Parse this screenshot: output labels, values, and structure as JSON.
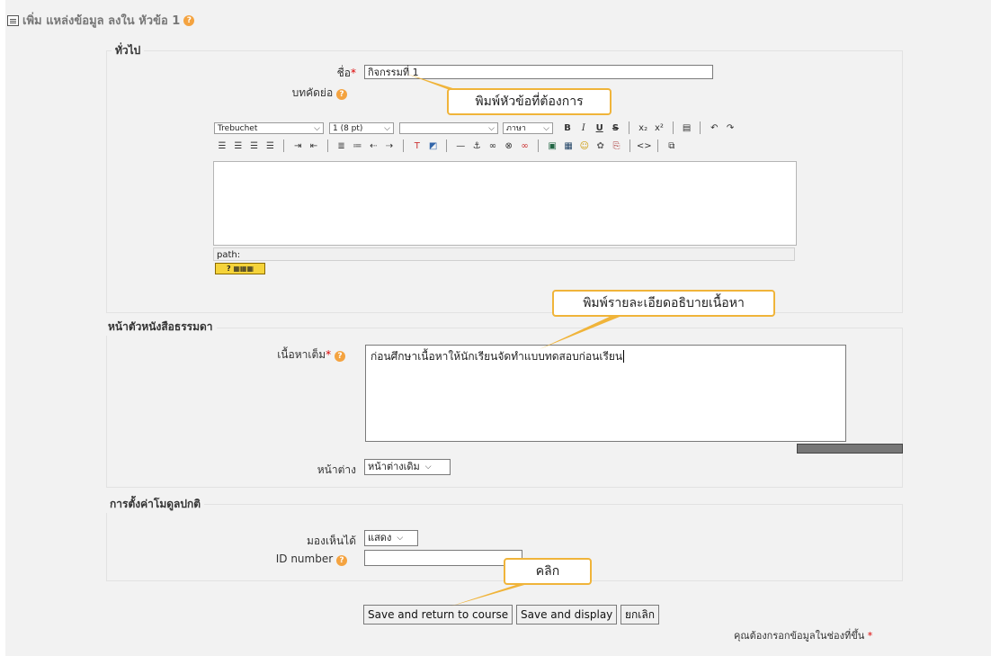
{
  "page": {
    "title": "เพิ่ม แหล่งข้อมูล ลงใน หัวข้อ 1",
    "help_glyph": "?"
  },
  "general": {
    "legend": "ทั่วไป",
    "name_label": "ชื่อ",
    "required_mark": "*",
    "name_value": "กิจกรรมที่ 1",
    "summary_label": "บทคัดย่อ",
    "editor": {
      "font_select": "Trebuchet",
      "size_select": "1 (8 pt)",
      "format_select": "",
      "lang_select": "ภาษา",
      "bold": "B",
      "italic": "I",
      "underline": "U",
      "strike": "S",
      "path_label": "path:"
    }
  },
  "plaintext": {
    "legend": "หน้าตัวหนังสือธรรมดา",
    "content_label": "เนื้อหาเต็ม",
    "content_value": "ก่อนศึกษาเนื้อหาให้นักเรียนจัดทำแบบทดสอบก่อนเรียน",
    "window_label": "หน้าต่าง",
    "window_value": "หน้าต่างเดิม"
  },
  "module": {
    "legend": "การตั้งค่าโมดูลปกติ",
    "visible_label": "มองเห็นได้",
    "visible_value": "แสดง",
    "idnumber_label": "ID number",
    "idnumber_value": ""
  },
  "buttons": {
    "save_return": "Save and return to course",
    "save_display": "Save and display",
    "cancel": "ยกเลิก"
  },
  "required_note": "คุณต้องกรอกข้อมูลในช่องที่ขึ้น",
  "callouts": {
    "title_hint": "พิมพ์หัวข้อที่ต้องการ",
    "content_hint": "พิมพ์รายละเอียดอธิบายเนื้อหา",
    "click_hint": "คลิก"
  },
  "colors": {
    "accent": "#f0b43a",
    "help": "#f4a340",
    "required": "#dd0000"
  }
}
